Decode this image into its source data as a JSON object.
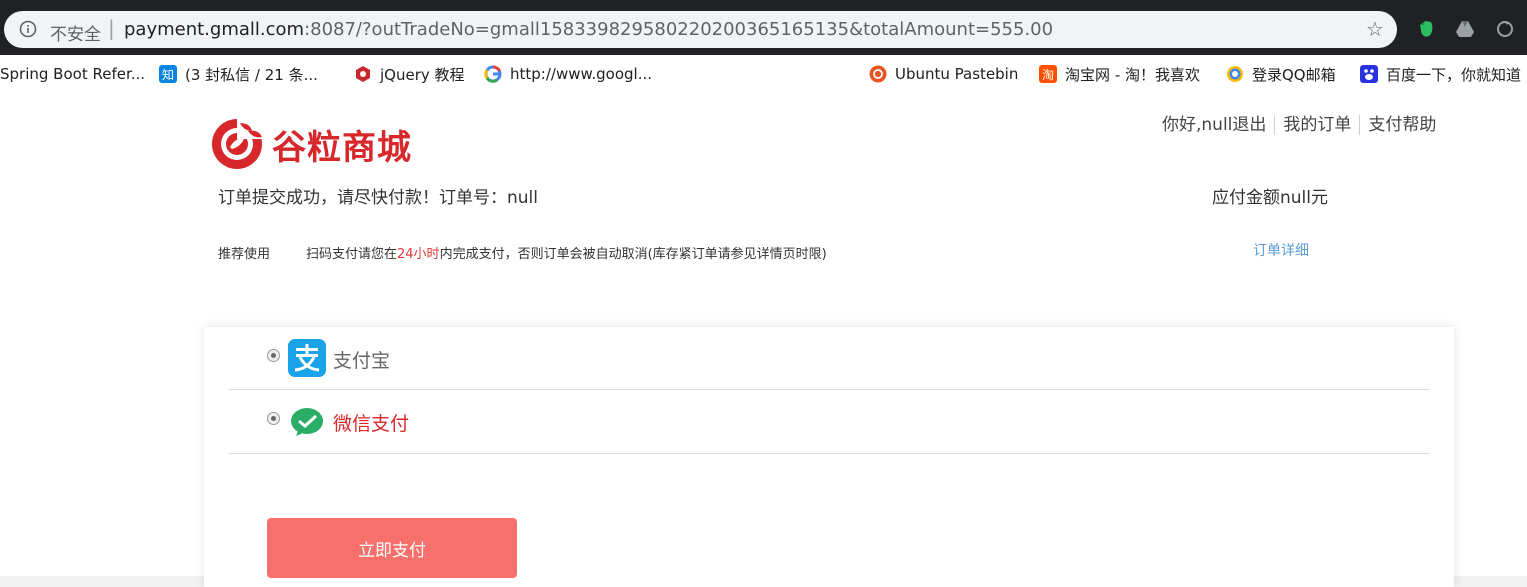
{
  "browser": {
    "insecure_label": "不安全",
    "url_host": "payment.gmall.com",
    "url_rest": ":8087/?outTradeNo=gmall158339829580220200365165135&totalAmount=555.00"
  },
  "bookmarks": [
    {
      "label": "Spring Boot Refer...",
      "icon": "spring-icon"
    },
    {
      "label": "(3 封私信 / 21 条...",
      "icon": "zhihu-icon",
      "icon_text": "知"
    },
    {
      "label": "jQuery 教程",
      "icon": "jquery-icon"
    },
    {
      "label": "http://www.googl...",
      "icon": "google-icon"
    },
    {
      "label": "Ubuntu Pastebin",
      "icon": "ubuntu-icon"
    },
    {
      "label": "淘宝网 - 淘！我喜欢",
      "icon": "taobao-icon",
      "icon_text": "淘"
    },
    {
      "label": "登录QQ邮箱",
      "icon": "qq-mail-icon"
    },
    {
      "label": "百度一下，你就知道",
      "icon": "baidu-icon"
    }
  ],
  "header": {
    "brand": "谷粒商城",
    "links": [
      "你好,null退出",
      "我的订单",
      "支付帮助"
    ]
  },
  "order": {
    "message": "订单提交成功，请尽快付款！订单号：null",
    "amount": "应付金额null元",
    "recommend": "推荐使用",
    "tip_prefix": "扫码支付请您在",
    "tip_highlight": "24小时",
    "tip_suffix": "内完成支付，否则订单会被自动取消(库存紧订单请参见详情页时限)",
    "detail_link": "订单详细"
  },
  "payment": {
    "options": [
      {
        "label": "支付宝",
        "color": "#666666"
      },
      {
        "label": "微信支付",
        "color": "#d7272a"
      }
    ],
    "pay_button": "立即支付"
  },
  "colors": {
    "brand_red": "#d7272a",
    "pay_button": "#f7706c",
    "link_blue": "#5b9bd5"
  }
}
